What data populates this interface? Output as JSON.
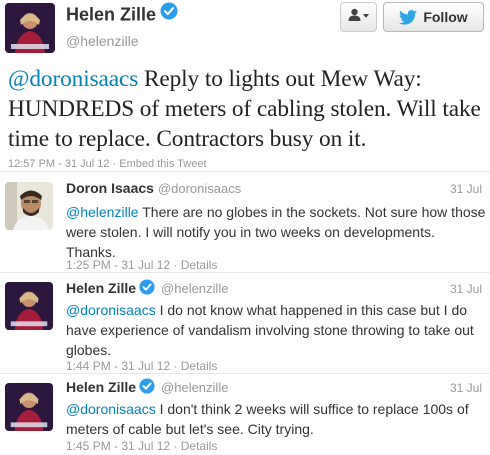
{
  "main_tweet": {
    "name": "Helen Zille",
    "handle": "@helenzille",
    "mention": "@doronisaacs",
    "text": " Reply to lights out Mew Way: HUNDREDS of meters of cabling stolen. Will take time to replace. Contractors busy on it.",
    "timestamp": "12:57 PM - 31 Jul 12",
    "separator": " · ",
    "embed_link": "Embed this Tweet"
  },
  "buttons": {
    "follow_label": "Follow",
    "person_menu_icon": "person-dropdown-icon",
    "bird_icon": "twitter-bird-icon"
  },
  "replies": [
    {
      "name": "Doron Isaacs",
      "handle": "@doronisaacs",
      "date": "31 Jul",
      "mention": "@helenzille",
      "text": " There are no globes in the sockets. Not sure how those were stolen. I will notify you in two weeks on developments. Thanks.",
      "timestamp": "1:25 PM - 31 Jul 12",
      "separator": " · ",
      "details": "Details",
      "verified": false
    },
    {
      "name": "Helen Zille",
      "handle": "@helenzille",
      "date": "31 Jul",
      "mention": "@doronisaacs",
      "text": " I do not know what happened in this case but I do have experience of vandalism involving stone throwing to take out globes.",
      "timestamp": "1:44 PM - 31 Jul 12",
      "separator": " · ",
      "details": "Details",
      "verified": true
    },
    {
      "name": "Helen Zille",
      "handle": "@helenzille",
      "date": "31 Jul",
      "mention": "@doronisaacs",
      "text": " I don't think 2 weeks will suffice to replace 100s of meters of cable but let's see. City trying.",
      "timestamp": "1:45 PM - 31 Jul 12",
      "separator": " · ",
      "details": "Details",
      "verified": true
    }
  ],
  "colors": {
    "link": "#0084b4",
    "muted": "#999999",
    "verified": "#2b9df0",
    "bird": "#2fa5e6"
  }
}
